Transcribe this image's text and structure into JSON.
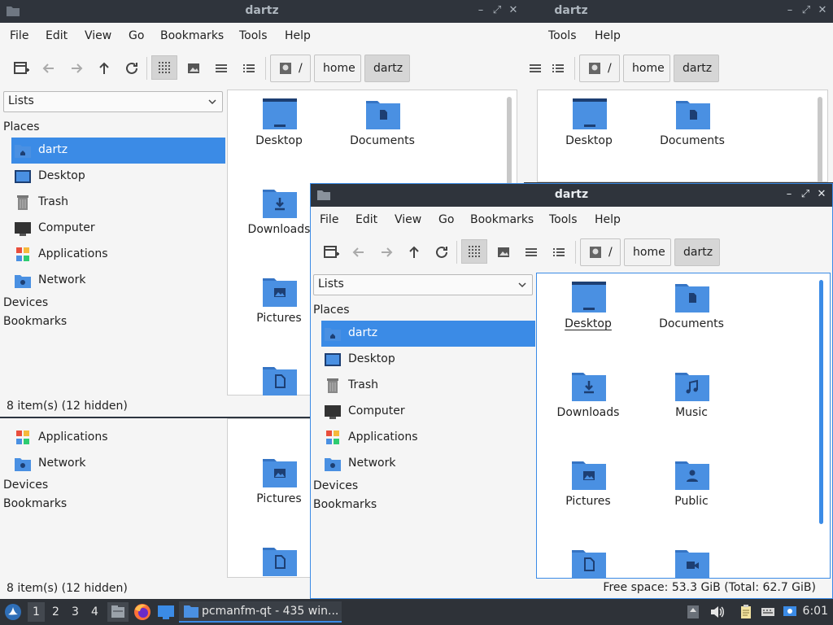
{
  "window_title": "dartz",
  "menu": [
    "File",
    "Edit",
    "View",
    "Go",
    "Bookmarks",
    "Tools",
    "Help"
  ],
  "path": {
    "root": "/",
    "segments": [
      "home",
      "dartz"
    ]
  },
  "side": {
    "combo_value": "Lists",
    "places_header": "Places",
    "places": [
      {
        "label": "dartz",
        "icon": "home-folder-icon"
      },
      {
        "label": "Desktop",
        "icon": "desktop-icon"
      },
      {
        "label": "Trash",
        "icon": "trash-icon"
      },
      {
        "label": "Computer",
        "icon": "computer-icon"
      },
      {
        "label": "Applications",
        "icon": "applications-icon"
      },
      {
        "label": "Network",
        "icon": "network-icon"
      }
    ],
    "devices_header": "Devices",
    "bookmarks_header": "Bookmarks"
  },
  "files": [
    "Desktop",
    "Documents",
    "Downloads",
    "Music",
    "Pictures",
    "Public"
  ],
  "status": {
    "count": "8 item(s) (12 hidden)",
    "free_space": "Free space: 53.3 GiB (Total: 62.7 GiB)"
  },
  "taskbar": {
    "workspaces": [
      "1",
      "2",
      "3",
      "4"
    ],
    "task_label": "pcmanfm-qt - 435 win...",
    "clock": "6:01"
  },
  "colors": {
    "accent": "#3b8be6",
    "folder": "#4a90e2",
    "titlebar": "#2f343c"
  }
}
